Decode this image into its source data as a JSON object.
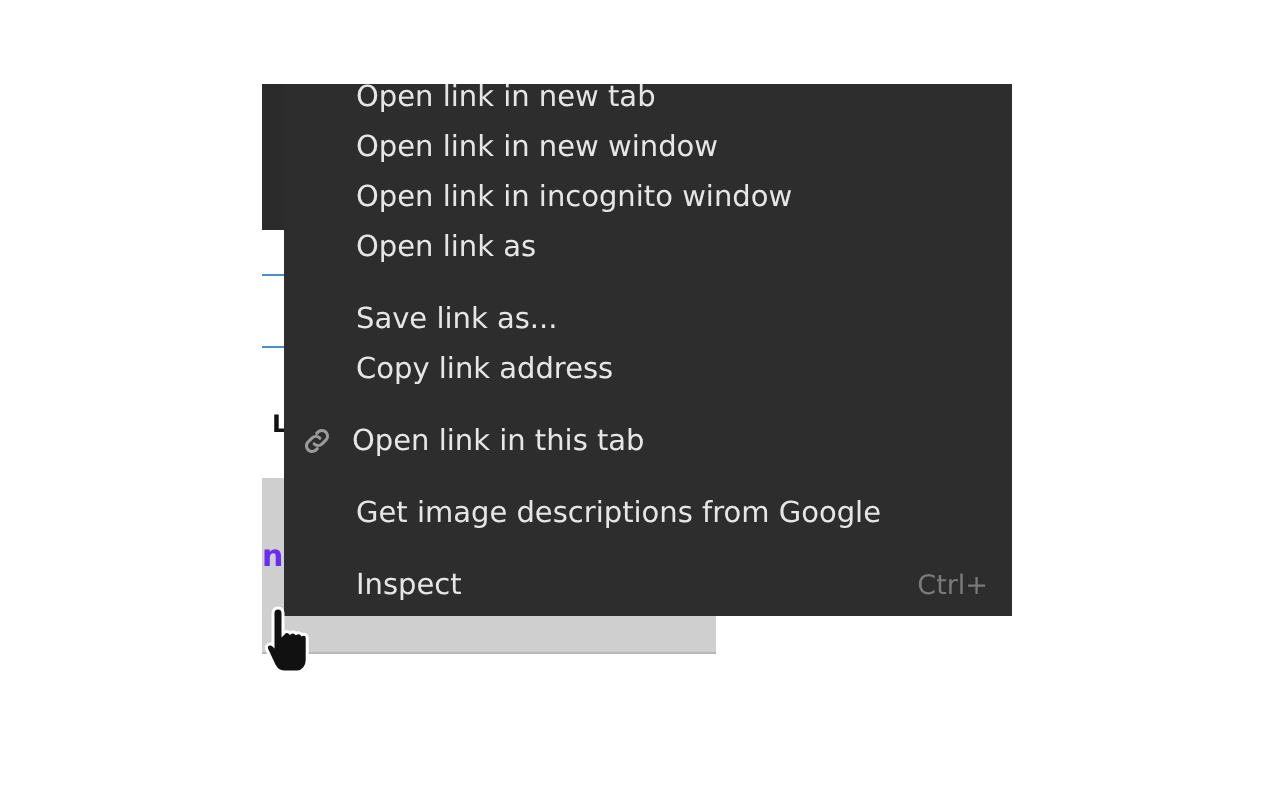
{
  "page": {
    "label": "L",
    "links": [
      "n"
    ]
  },
  "context_menu": {
    "groups": [
      [
        {
          "kind": "item",
          "label": "Open link in new tab"
        },
        {
          "kind": "item",
          "label": "Open link in new window"
        },
        {
          "kind": "item",
          "label": "Open link in incognito window"
        },
        {
          "kind": "item",
          "label": "Open link as"
        }
      ],
      [
        {
          "kind": "item",
          "label": "Save link as..."
        },
        {
          "kind": "item",
          "label": "Copy link address"
        }
      ],
      [
        {
          "kind": "link-item",
          "label": "Open link in this tab"
        }
      ],
      [
        {
          "kind": "item",
          "label": "Get image descriptions from Google"
        }
      ],
      [
        {
          "kind": "item",
          "label": "Inspect",
          "shortcut": "Ctrl+"
        }
      ]
    ]
  }
}
